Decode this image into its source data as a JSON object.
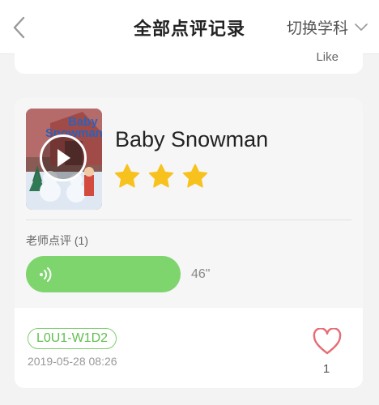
{
  "header": {
    "title": "全部点评记录",
    "switch_label": "切换学科"
  },
  "previous_card": {
    "like_label": "Like"
  },
  "card": {
    "cover_title_line1": "Baby",
    "cover_title_line2": "Snowman",
    "book_title": "Baby Snowman",
    "stars": 3,
    "review_label": "老师点评 (1)",
    "voice_duration": "46\"",
    "tag": "L0U1-W1D2",
    "date": "2019-05-28 08:26",
    "like_count": "1"
  },
  "colors": {
    "accent_green": "#7ed46d",
    "star": "#f7c21e",
    "heart": "#e76b74"
  },
  "icons": [
    "back-arrow-icon",
    "chevron-down-icon",
    "play-icon",
    "star-icon",
    "voice-wave-icon",
    "heart-icon"
  ]
}
